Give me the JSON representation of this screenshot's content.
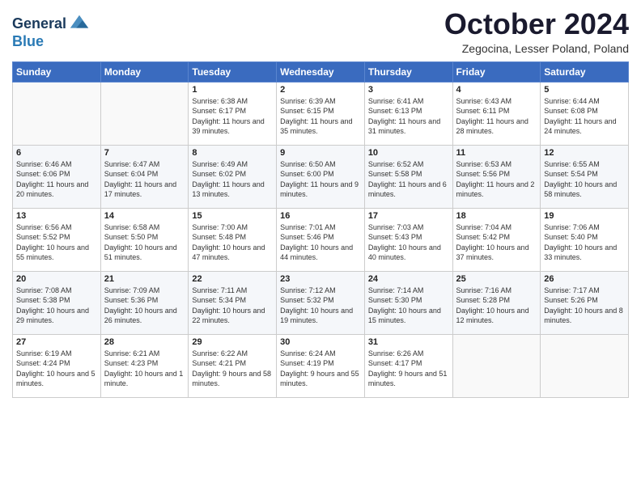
{
  "header": {
    "logo_line1": "General",
    "logo_line2": "Blue",
    "month_title": "October 2024",
    "subtitle": "Zegocina, Lesser Poland, Poland"
  },
  "weekdays": [
    "Sunday",
    "Monday",
    "Tuesday",
    "Wednesday",
    "Thursday",
    "Friday",
    "Saturday"
  ],
  "weeks": [
    [
      {
        "day": "",
        "info": ""
      },
      {
        "day": "",
        "info": ""
      },
      {
        "day": "1",
        "info": "Sunrise: 6:38 AM\nSunset: 6:17 PM\nDaylight: 11 hours and 39 minutes."
      },
      {
        "day": "2",
        "info": "Sunrise: 6:39 AM\nSunset: 6:15 PM\nDaylight: 11 hours and 35 minutes."
      },
      {
        "day": "3",
        "info": "Sunrise: 6:41 AM\nSunset: 6:13 PM\nDaylight: 11 hours and 31 minutes."
      },
      {
        "day": "4",
        "info": "Sunrise: 6:43 AM\nSunset: 6:11 PM\nDaylight: 11 hours and 28 minutes."
      },
      {
        "day": "5",
        "info": "Sunrise: 6:44 AM\nSunset: 6:08 PM\nDaylight: 11 hours and 24 minutes."
      }
    ],
    [
      {
        "day": "6",
        "info": "Sunrise: 6:46 AM\nSunset: 6:06 PM\nDaylight: 11 hours and 20 minutes."
      },
      {
        "day": "7",
        "info": "Sunrise: 6:47 AM\nSunset: 6:04 PM\nDaylight: 11 hours and 17 minutes."
      },
      {
        "day": "8",
        "info": "Sunrise: 6:49 AM\nSunset: 6:02 PM\nDaylight: 11 hours and 13 minutes."
      },
      {
        "day": "9",
        "info": "Sunrise: 6:50 AM\nSunset: 6:00 PM\nDaylight: 11 hours and 9 minutes."
      },
      {
        "day": "10",
        "info": "Sunrise: 6:52 AM\nSunset: 5:58 PM\nDaylight: 11 hours and 6 minutes."
      },
      {
        "day": "11",
        "info": "Sunrise: 6:53 AM\nSunset: 5:56 PM\nDaylight: 11 hours and 2 minutes."
      },
      {
        "day": "12",
        "info": "Sunrise: 6:55 AM\nSunset: 5:54 PM\nDaylight: 10 hours and 58 minutes."
      }
    ],
    [
      {
        "day": "13",
        "info": "Sunrise: 6:56 AM\nSunset: 5:52 PM\nDaylight: 10 hours and 55 minutes."
      },
      {
        "day": "14",
        "info": "Sunrise: 6:58 AM\nSunset: 5:50 PM\nDaylight: 10 hours and 51 minutes."
      },
      {
        "day": "15",
        "info": "Sunrise: 7:00 AM\nSunset: 5:48 PM\nDaylight: 10 hours and 47 minutes."
      },
      {
        "day": "16",
        "info": "Sunrise: 7:01 AM\nSunset: 5:46 PM\nDaylight: 10 hours and 44 minutes."
      },
      {
        "day": "17",
        "info": "Sunrise: 7:03 AM\nSunset: 5:43 PM\nDaylight: 10 hours and 40 minutes."
      },
      {
        "day": "18",
        "info": "Sunrise: 7:04 AM\nSunset: 5:42 PM\nDaylight: 10 hours and 37 minutes."
      },
      {
        "day": "19",
        "info": "Sunrise: 7:06 AM\nSunset: 5:40 PM\nDaylight: 10 hours and 33 minutes."
      }
    ],
    [
      {
        "day": "20",
        "info": "Sunrise: 7:08 AM\nSunset: 5:38 PM\nDaylight: 10 hours and 29 minutes."
      },
      {
        "day": "21",
        "info": "Sunrise: 7:09 AM\nSunset: 5:36 PM\nDaylight: 10 hours and 26 minutes."
      },
      {
        "day": "22",
        "info": "Sunrise: 7:11 AM\nSunset: 5:34 PM\nDaylight: 10 hours and 22 minutes."
      },
      {
        "day": "23",
        "info": "Sunrise: 7:12 AM\nSunset: 5:32 PM\nDaylight: 10 hours and 19 minutes."
      },
      {
        "day": "24",
        "info": "Sunrise: 7:14 AM\nSunset: 5:30 PM\nDaylight: 10 hours and 15 minutes."
      },
      {
        "day": "25",
        "info": "Sunrise: 7:16 AM\nSunset: 5:28 PM\nDaylight: 10 hours and 12 minutes."
      },
      {
        "day": "26",
        "info": "Sunrise: 7:17 AM\nSunset: 5:26 PM\nDaylight: 10 hours and 8 minutes."
      }
    ],
    [
      {
        "day": "27",
        "info": "Sunrise: 6:19 AM\nSunset: 4:24 PM\nDaylight: 10 hours and 5 minutes."
      },
      {
        "day": "28",
        "info": "Sunrise: 6:21 AM\nSunset: 4:23 PM\nDaylight: 10 hours and 1 minute."
      },
      {
        "day": "29",
        "info": "Sunrise: 6:22 AM\nSunset: 4:21 PM\nDaylight: 9 hours and 58 minutes."
      },
      {
        "day": "30",
        "info": "Sunrise: 6:24 AM\nSunset: 4:19 PM\nDaylight: 9 hours and 55 minutes."
      },
      {
        "day": "31",
        "info": "Sunrise: 6:26 AM\nSunset: 4:17 PM\nDaylight: 9 hours and 51 minutes."
      },
      {
        "day": "",
        "info": ""
      },
      {
        "day": "",
        "info": ""
      }
    ]
  ]
}
